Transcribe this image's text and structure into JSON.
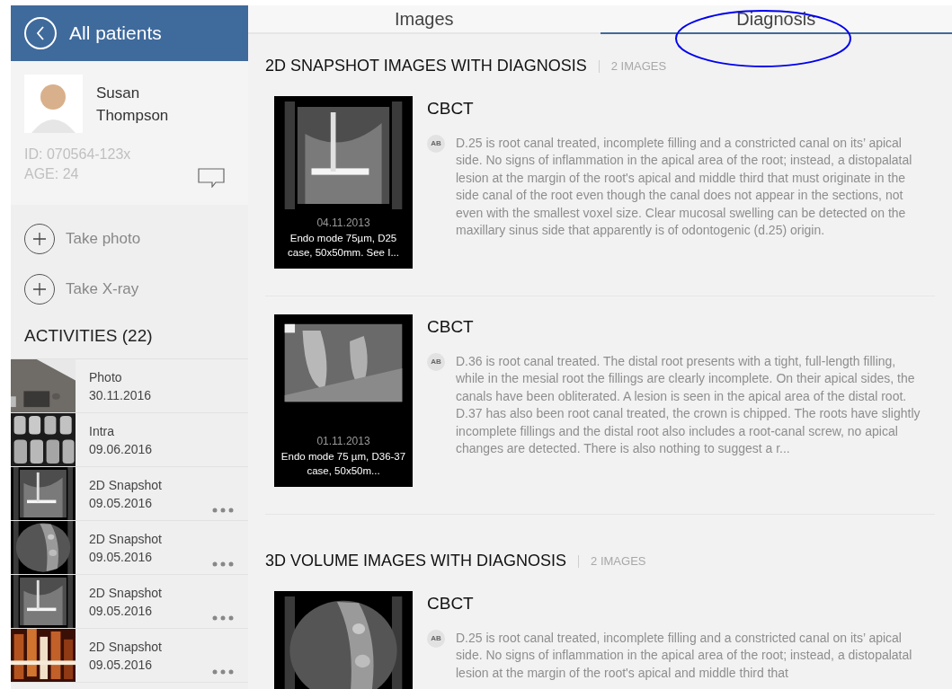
{
  "header": {
    "title": "All patients"
  },
  "patient": {
    "first_name": "Susan",
    "last_name": "Thompson",
    "id": "ID: 070564-123x",
    "age": "AGE: 24"
  },
  "actions": [
    {
      "label": "Take photo"
    },
    {
      "label": "Take X-ray"
    }
  ],
  "activities": {
    "title": "ACTIVITIES (22)",
    "items": [
      {
        "type": "Photo",
        "date": "30.11.2016",
        "more": false
      },
      {
        "type": "Intra",
        "date": "09.06.2016",
        "more": false
      },
      {
        "type": "2D Snapshot",
        "date": "09.05.2016",
        "more": true
      },
      {
        "type": "2D Snapshot",
        "date": "09.05.2016",
        "more": true
      },
      {
        "type": "2D Snapshot",
        "date": "09.05.2016",
        "more": true
      },
      {
        "type": "2D Snapshot",
        "date": "09.05.2016",
        "more": true
      }
    ]
  },
  "tabs": [
    {
      "label": "Images",
      "selected": false
    },
    {
      "label": "Diagnosis",
      "selected": true
    }
  ],
  "sections": [
    {
      "title": "2D SNAPSHOT IMAGES WITH DIAGNOSIS",
      "count": "2 IMAGES",
      "items": [
        {
          "date": "04.11.2013",
          "caption": "Endo mode 75µm, D25 case, 50x50mm. See I...",
          "title": "CBCT",
          "author": "AB",
          "text": "D.25 is root canal treated, incomplete filling and a constricted canal on its’ apical side. No signs of inflammation in the apical area of the root; instead, a distopalatal lesion at the margin of the root's apical and middle third that must originate in the side canal of the root even though the canal does not appear in the sections, not even with the smallest voxel size. Clear mucosal swelling can be detected on the maxillary sinus side that apparently is of odontogenic (d.25) origin."
        },
        {
          "date": "01.11.2013",
          "caption": "Endo mode 75 µm, D36-37 case, 50x50m...",
          "title": "CBCT",
          "author": "AB",
          "text": "D.36 is root canal treated. The distal root presents with a tight, full-length filling, while in the mesial root the fillings are clearly incomplete. On their apical sides, the canals have been obliterated. A lesion is seen in the apical area of the distal root.\nD.37 has also been root canal treated, the crown is chipped. The roots have slightly incomplete fillings and the distal root also includes a root-canal screw, no apical changes are detected. There is also nothing to suggest a r..."
        }
      ]
    },
    {
      "title": "3D VOLUME IMAGES WITH DIAGNOSIS",
      "count": "2 IMAGES",
      "items": [
        {
          "title": "CBCT",
          "author": "AB",
          "text": "D.25 is root canal treated, incomplete filling and a constricted canal on its’ apical side. No signs of inflammation in the apical area of the root; instead, a distopalatal lesion at the margin of the root's apical and middle third that"
        }
      ]
    }
  ]
}
